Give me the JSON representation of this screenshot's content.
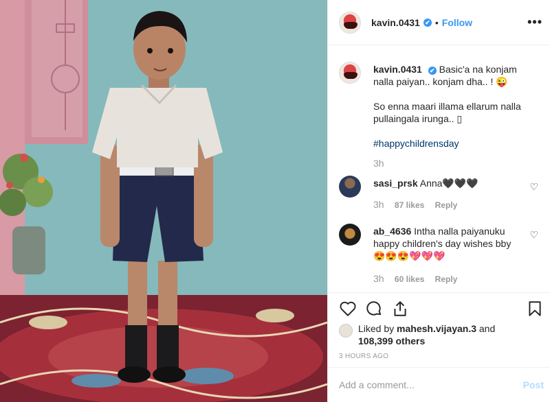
{
  "header": {
    "username": "kavin.0431",
    "verified_mark": "✔",
    "separator": "•",
    "follow_label": "Follow",
    "more_label": "•••"
  },
  "caption": {
    "username": "kavin.0431",
    "line1": "Basic'a na konjam nalla paiyan.. konjam dha.. ! 😜",
    "line2": "So enna maari illama ellarum nalla pullaingala irunga.. ▯",
    "hashtag": "#happychildrensday",
    "time": "3h"
  },
  "comments": [
    {
      "username": "sasi_prsk",
      "text": "Anna🖤🖤🖤",
      "time": "3h",
      "likes": "87 likes",
      "reply": "Reply"
    },
    {
      "username": "ab_4636",
      "text": "Intha nalla paiyanuku happy children's day wishes bby 😍😍😍💖💖💖",
      "time": "3h",
      "likes": "60 likes",
      "reply": "Reply"
    }
  ],
  "likes": {
    "prefix": "Liked by",
    "user": "mahesh.vijayan.3",
    "middle": "and",
    "count": "108,399 others"
  },
  "posted": "3 HOURS AGO",
  "add_comment": {
    "placeholder": "Add a comment...",
    "post_label": "Post"
  },
  "icons": {
    "like": "heart-icon",
    "comment": "comment-bubble-icon",
    "share": "share-icon",
    "save": "bookmark-icon",
    "more": "more-options-icon",
    "comment_like": "small-heart-icon"
  },
  "colors": {
    "link_blue": "#3897f0",
    "post_disabled": "#b3dbff",
    "muted": "#999999",
    "text": "#262626",
    "border": "#efefef"
  }
}
